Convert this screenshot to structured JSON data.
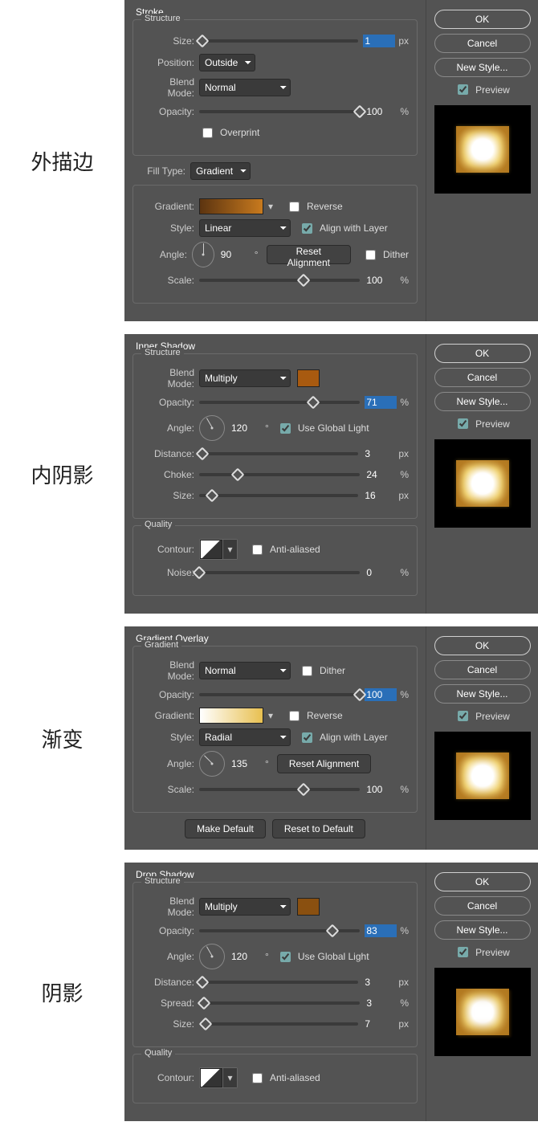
{
  "common": {
    "ok": "OK",
    "cancel": "Cancel",
    "newStyle": "New Style...",
    "preview": "Preview",
    "blendMode": "Blend Mode:",
    "opacity": "Opacity:",
    "angle": "Angle:",
    "size": "Size:",
    "scale": "Scale:",
    "structure": "Structure",
    "quality": "Quality",
    "contour": "Contour:",
    "noise": "Noise:",
    "antiAliased": "Anti-aliased",
    "useGlobalLight": "Use Global Light",
    "resetAlignment": "Reset Alignment",
    "alignWithLayer": "Align with Layer",
    "reverse": "Reverse",
    "dither": "Dither",
    "px": "px",
    "pct": "%",
    "deg": "°",
    "gradient": "Gradient:",
    "style": "Style:",
    "distance": "Distance:"
  },
  "stroke": {
    "cnLabel": "外描边",
    "title": "Stroke",
    "sizeVal": "1",
    "position": "Position:",
    "positionVal": "Outside",
    "blendModeVal": "Normal",
    "opacityVal": "100",
    "overprint": "Overprint",
    "fillType": "Fill Type:",
    "fillTypeVal": "Gradient",
    "styleVal": "Linear",
    "angleVal": "90",
    "scaleVal": "100"
  },
  "innerShadow": {
    "cnLabel": "内阴影",
    "title": "Inner Shadow",
    "blendModeVal": "Multiply",
    "opacityVal": "71",
    "angleVal": "120",
    "distanceVal": "3",
    "choke": "Choke:",
    "chokeVal": "24",
    "sizeVal": "16",
    "noiseVal": "0"
  },
  "gradientOverlay": {
    "cnLabel": "渐变",
    "title": "Gradient Overlay",
    "subTitle": "Gradient",
    "blendModeVal": "Normal",
    "opacityVal": "100",
    "styleVal": "Radial",
    "angleVal": "135",
    "scaleVal": "100",
    "makeDefault": "Make Default",
    "resetDefault": "Reset to Default"
  },
  "dropShadow": {
    "cnLabel": "阴影",
    "title": "Drop Shadow",
    "blendModeVal": "Multiply",
    "opacityVal": "83",
    "angleVal": "120",
    "distanceVal": "3",
    "spread": "Spread:",
    "spreadVal": "3",
    "sizeVal": "7"
  }
}
